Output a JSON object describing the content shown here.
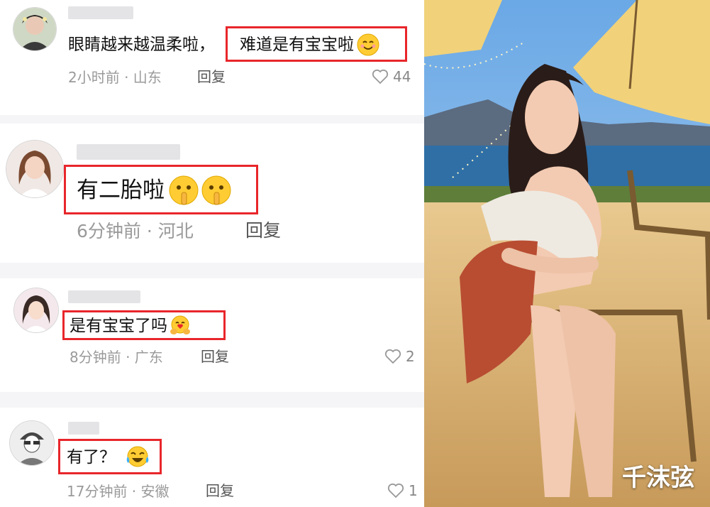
{
  "comments": [
    {
      "text": "眼睛越来越温柔啦，",
      "highlight": "难道是有宝宝啦",
      "emoji": "smiling-face-icon",
      "meta": "2小时前 · 山东",
      "reply": "回复",
      "likes": "44"
    },
    {
      "highlight": "有二胎啦",
      "emoji": "shushing-face-icon",
      "meta": "6分钟前 · 河北",
      "reply": "回复",
      "likes": ""
    },
    {
      "highlight": "是有宝宝了吗",
      "emoji": "hugging-face-icon",
      "meta": "8分钟前 · 广东",
      "reply": "回复",
      "likes": "2"
    },
    {
      "highlight": "有了？",
      "emoji": "tears-of-joy-icon",
      "meta": "17分钟前 · 安徽",
      "reply": "回复",
      "likes": "1"
    }
  ],
  "watermark": "千沫弦",
  "colors": {
    "highlight_border": "#e8262b",
    "meta_text": "#9a9a9a",
    "background": "#ffffff"
  }
}
